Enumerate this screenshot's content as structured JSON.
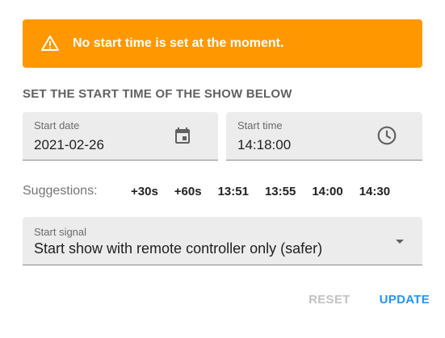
{
  "alert": {
    "icon": "warning-icon",
    "message": "No start time is set at the moment.",
    "color": "#ff9800"
  },
  "section_title": "SET THE START TIME OF THE SHOW BELOW",
  "start_date": {
    "label": "Start date",
    "value": "2021-02-26",
    "icon": "calendar-icon"
  },
  "start_time": {
    "label": "Start time",
    "value": "14:18:00",
    "icon": "clock-icon"
  },
  "suggestions": {
    "label": "Suggestions:",
    "items": [
      "+30s",
      "+60s",
      "13:51",
      "13:55",
      "14:00",
      "14:30"
    ]
  },
  "start_signal": {
    "label": "Start signal",
    "value": "Start show with remote controller only (safer)",
    "icon": "dropdown-arrow-icon"
  },
  "actions": {
    "reset_label": "RESET",
    "update_label": "UPDATE",
    "accent_color": "#2196f3"
  }
}
